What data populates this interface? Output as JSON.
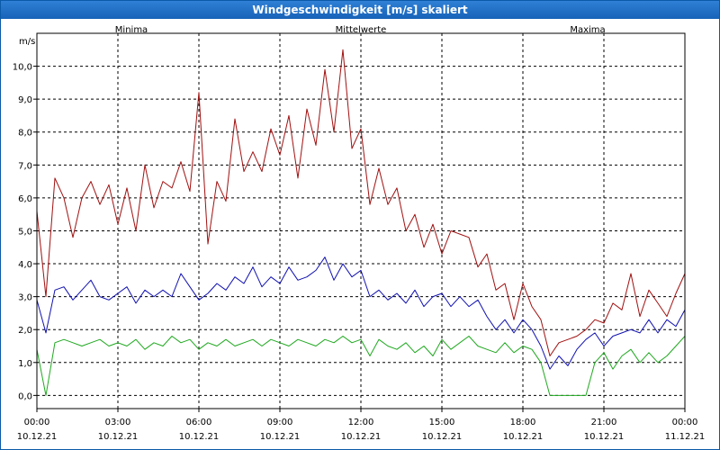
{
  "window": {
    "title": "Windgeschwindigkeit [m/s] skaliert"
  },
  "chart_data": {
    "type": "line",
    "title": "Windgeschwindigkeit [m/s] skaliert",
    "ylabel": "m/s",
    "ylim": [
      -0.4,
      11.0
    ],
    "xlim": [
      "10.12.21 00:00",
      "11.12.21 00:00"
    ],
    "y_ticks": [
      "0,0",
      "1,0",
      "2,0",
      "3,0",
      "4,0",
      "5,0",
      "6,0",
      "7,0",
      "8,0",
      "9,0",
      "10,0"
    ],
    "x_ticks": [
      {
        "time": "00:00",
        "date": "10.12.21"
      },
      {
        "time": "03:00",
        "date": "10.12.21"
      },
      {
        "time": "06:00",
        "date": "10.12.21"
      },
      {
        "time": "09:00",
        "date": "10.12.21"
      },
      {
        "time": "12:00",
        "date": "10.12.21"
      },
      {
        "time": "15:00",
        "date": "10.12.21"
      },
      {
        "time": "18:00",
        "date": "10.12.21"
      },
      {
        "time": "21:00",
        "date": "10.12.21"
      },
      {
        "time": "00:00",
        "date": "11.12.21"
      }
    ],
    "grid": true,
    "legend_position": "top",
    "series": [
      {
        "name": "Minima",
        "color": "#1fa81f",
        "x": [
          "00:00",
          "00:20",
          "00:40",
          "01:00",
          "01:20",
          "01:40",
          "02:00",
          "02:20",
          "02:40",
          "03:00",
          "03:20",
          "03:40",
          "04:00",
          "04:20",
          "04:40",
          "05:00",
          "05:20",
          "05:40",
          "06:00",
          "06:20",
          "06:40",
          "07:00",
          "07:20",
          "07:40",
          "08:00",
          "08:20",
          "08:40",
          "09:00",
          "09:20",
          "09:40",
          "10:00",
          "10:20",
          "10:40",
          "11:00",
          "11:20",
          "11:40",
          "12:00",
          "12:20",
          "12:40",
          "13:00",
          "13:20",
          "13:40",
          "14:00",
          "14:20",
          "14:40",
          "15:00",
          "15:20",
          "15:40",
          "16:00",
          "16:20",
          "16:40",
          "17:00",
          "17:20",
          "17:40",
          "18:00",
          "18:20",
          "18:40",
          "19:00",
          "19:20",
          "19:40",
          "20:00",
          "20:20",
          "20:40",
          "21:00",
          "21:20",
          "21:40",
          "22:00",
          "22:20",
          "22:40",
          "23:00",
          "23:20",
          "23:40",
          "24:00"
        ],
        "y": [
          1.4,
          0.0,
          1.6,
          1.7,
          1.6,
          1.5,
          1.6,
          1.7,
          1.5,
          1.6,
          1.5,
          1.7,
          1.4,
          1.6,
          1.5,
          1.8,
          1.6,
          1.7,
          1.4,
          1.6,
          1.5,
          1.7,
          1.5,
          1.6,
          1.7,
          1.5,
          1.7,
          1.6,
          1.5,
          1.7,
          1.6,
          1.5,
          1.7,
          1.6,
          1.8,
          1.6,
          1.7,
          1.2,
          1.7,
          1.5,
          1.4,
          1.6,
          1.3,
          1.5,
          1.2,
          1.7,
          1.4,
          1.6,
          1.8,
          1.5,
          1.4,
          1.3,
          1.6,
          1.3,
          1.5,
          1.4,
          1.0,
          0.0,
          0.0,
          0.0,
          0.0,
          0.0,
          1.0,
          1.3,
          0.8,
          1.2,
          1.4,
          1.0,
          1.3,
          1.0,
          1.2,
          1.5,
          1.8
        ]
      },
      {
        "name": "Mittelwerte",
        "color": "#1010b0",
        "x": [
          "00:00",
          "00:20",
          "00:40",
          "01:00",
          "01:20",
          "01:40",
          "02:00",
          "02:20",
          "02:40",
          "03:00",
          "03:20",
          "03:40",
          "04:00",
          "04:20",
          "04:40",
          "05:00",
          "05:20",
          "05:40",
          "06:00",
          "06:20",
          "06:40",
          "07:00",
          "07:20",
          "07:40",
          "08:00",
          "08:20",
          "08:40",
          "09:00",
          "09:20",
          "09:40",
          "10:00",
          "10:20",
          "10:40",
          "11:00",
          "11:20",
          "11:40",
          "12:00",
          "12:20",
          "12:40",
          "13:00",
          "13:20",
          "13:40",
          "14:00",
          "14:20",
          "14:40",
          "15:00",
          "15:20",
          "15:40",
          "16:00",
          "16:20",
          "16:40",
          "17:00",
          "17:20",
          "17:40",
          "18:00",
          "18:20",
          "18:40",
          "19:00",
          "19:20",
          "19:40",
          "20:00",
          "20:20",
          "20:40",
          "21:00",
          "21:20",
          "21:40",
          "22:00",
          "22:20",
          "22:40",
          "23:00",
          "23:20",
          "23:40",
          "24:00"
        ],
        "y": [
          2.9,
          1.9,
          3.2,
          3.3,
          2.9,
          3.2,
          3.5,
          3.0,
          2.9,
          3.1,
          3.3,
          2.8,
          3.2,
          3.0,
          3.2,
          3.0,
          3.7,
          3.3,
          2.9,
          3.1,
          3.4,
          3.2,
          3.6,
          3.4,
          3.9,
          3.3,
          3.6,
          3.4,
          3.9,
          3.5,
          3.6,
          3.8,
          4.2,
          3.5,
          4.0,
          3.6,
          3.8,
          3.0,
          3.2,
          2.9,
          3.1,
          2.8,
          3.2,
          2.7,
          3.0,
          3.1,
          2.7,
          3.0,
          2.7,
          2.9,
          2.4,
          2.0,
          2.3,
          1.9,
          2.3,
          2.0,
          1.5,
          0.8,
          1.2,
          0.9,
          1.4,
          1.7,
          1.9,
          1.5,
          1.8,
          1.9,
          2.0,
          1.9,
          2.3,
          1.9,
          2.3,
          2.1,
          2.6
        ]
      },
      {
        "name": "Maxima",
        "color": "#a01010",
        "x": [
          "00:00",
          "00:20",
          "00:40",
          "01:00",
          "01:20",
          "01:40",
          "02:00",
          "02:20",
          "02:40",
          "03:00",
          "03:20",
          "03:40",
          "04:00",
          "04:20",
          "04:40",
          "05:00",
          "05:20",
          "05:40",
          "06:00",
          "06:20",
          "06:40",
          "07:00",
          "07:20",
          "07:40",
          "08:00",
          "08:20",
          "08:40",
          "09:00",
          "09:20",
          "09:40",
          "10:00",
          "10:20",
          "10:40",
          "11:00",
          "11:20",
          "11:40",
          "12:00",
          "12:20",
          "12:40",
          "13:00",
          "13:20",
          "13:40",
          "14:00",
          "14:20",
          "14:40",
          "15:00",
          "15:20",
          "15:40",
          "16:00",
          "16:20",
          "16:40",
          "17:00",
          "17:20",
          "17:40",
          "18:00",
          "18:20",
          "18:40",
          "19:00",
          "19:20",
          "19:40",
          "20:00",
          "20:20",
          "20:40",
          "21:00",
          "21:20",
          "21:40",
          "22:00",
          "22:20",
          "22:40",
          "23:00",
          "23:20",
          "23:40",
          "24:00"
        ],
        "y": [
          5.6,
          3.0,
          6.6,
          6.0,
          4.8,
          6.0,
          6.5,
          5.8,
          6.4,
          5.2,
          6.3,
          5.0,
          7.0,
          5.7,
          6.5,
          6.3,
          7.1,
          6.2,
          9.2,
          4.6,
          6.5,
          5.9,
          8.4,
          6.8,
          7.4,
          6.8,
          8.1,
          7.3,
          8.5,
          6.6,
          8.7,
          7.6,
          9.9,
          8.0,
          10.5,
          7.5,
          8.1,
          5.8,
          6.9,
          5.8,
          6.3,
          5.0,
          5.5,
          4.5,
          5.2,
          4.3,
          5.0,
          4.9,
          4.8,
          3.9,
          4.3,
          3.2,
          3.4,
          2.3,
          3.4,
          2.7,
          2.3,
          1.2,
          1.6,
          1.7,
          1.8,
          2.0,
          2.3,
          2.2,
          2.8,
          2.6,
          3.7,
          2.4,
          3.2,
          2.8,
          2.4,
          3.1,
          3.7
        ]
      }
    ]
  }
}
